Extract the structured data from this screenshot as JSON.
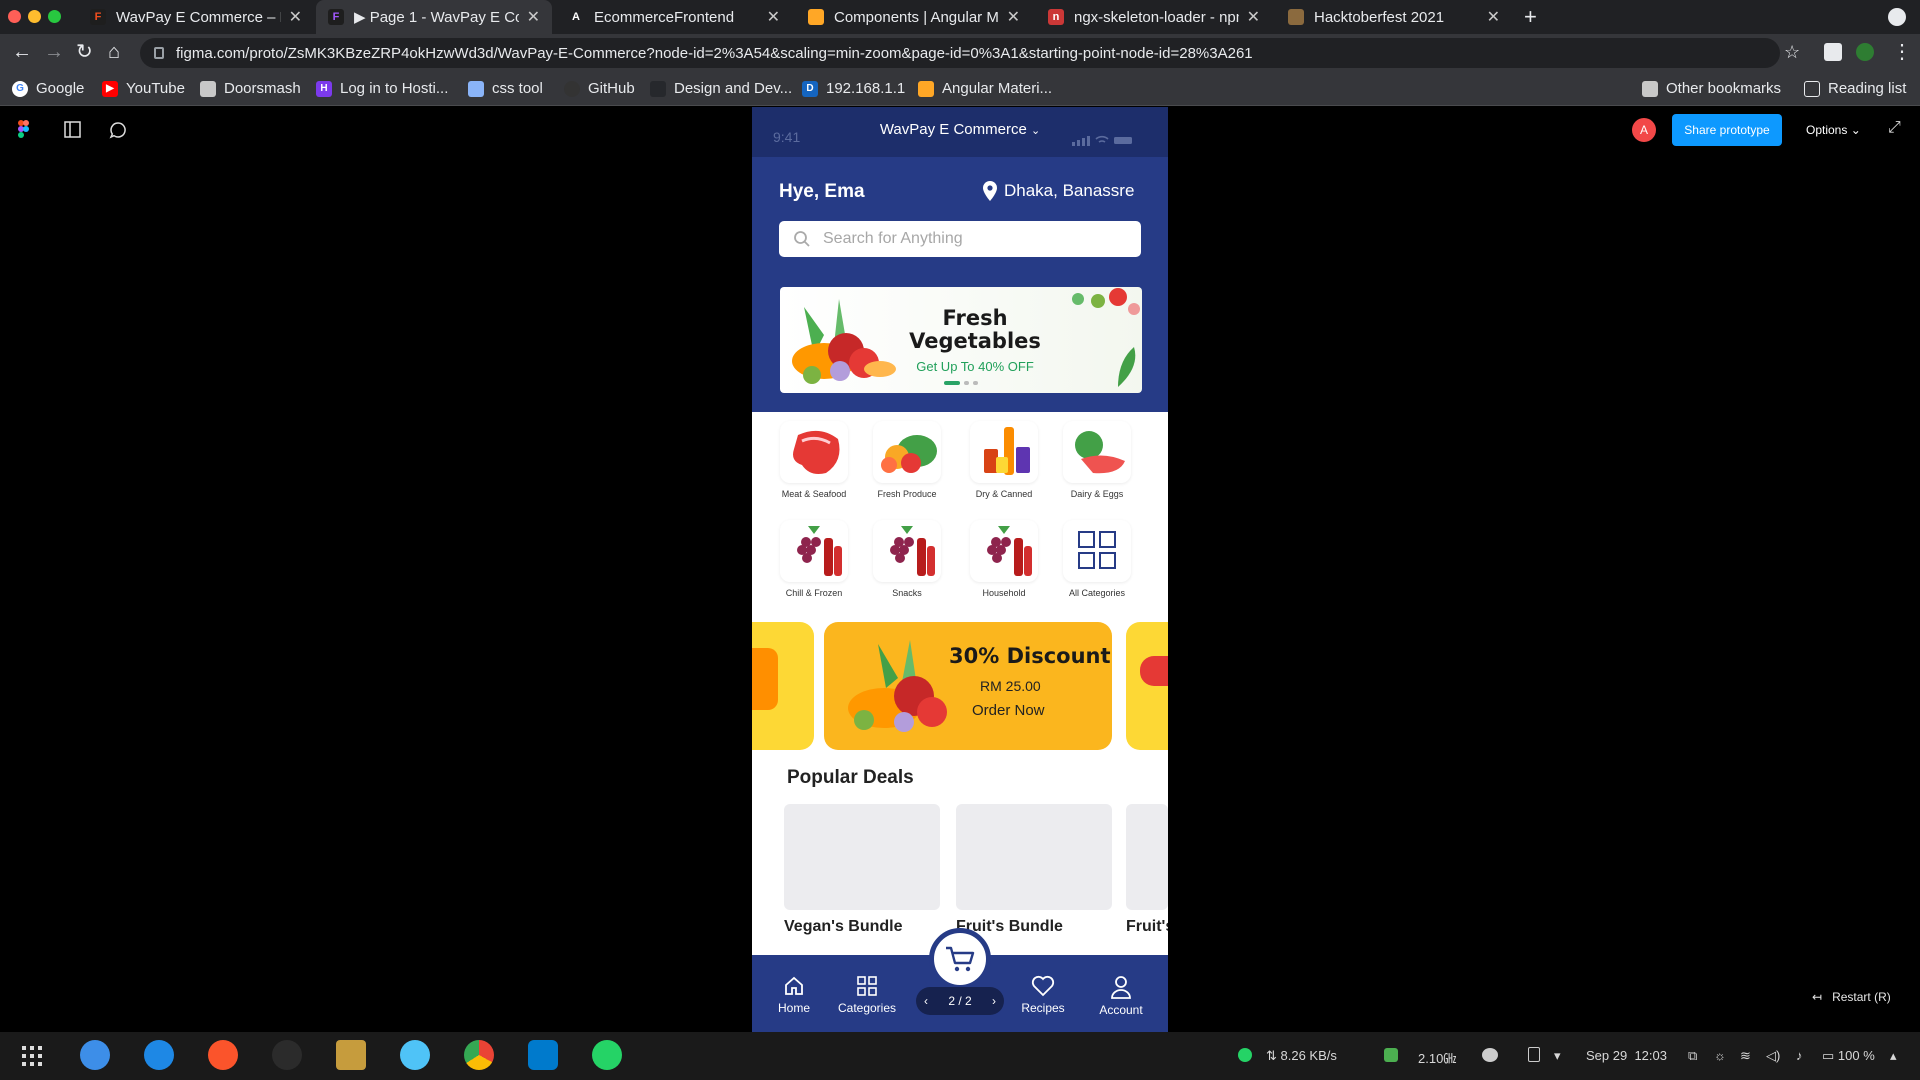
{
  "browser": {
    "tabs": [
      {
        "label": "WavPay E Commerce – Fi",
        "active": false,
        "favicon": "figma-icon"
      },
      {
        "label": "▶ Page 1 - WavPay E Com",
        "active": true,
        "favicon": "figma-icon"
      },
      {
        "label": "EcommerceFrontend",
        "active": false,
        "favicon": "angular-icon"
      },
      {
        "label": "Components | Angular Ma",
        "active": false,
        "favicon": "angular-material-icon"
      },
      {
        "label": "ngx-skeleton-loader - npm",
        "active": false,
        "favicon": "npm-icon"
      },
      {
        "label": "Hacktoberfest 2021",
        "active": false,
        "favicon": "hacktoberfest-icon"
      }
    ],
    "url": "figma.com/proto/ZsMK3KBzeZRP4okHzwWd3d/WavPay-E-Commerce?node-id=2%3A54&scaling=min-zoom&page-id=0%3A1&starting-point-node-id=28%3A261",
    "bookmarks": [
      {
        "label": "Google",
        "icon": "google-icon"
      },
      {
        "label": "YouTube",
        "icon": "youtube-icon"
      },
      {
        "label": "Doorsmash",
        "icon": "folder-icon"
      },
      {
        "label": "Log in to Hosti...",
        "icon": "hosting-icon"
      },
      {
        "label": "css tool",
        "icon": "folder-icon"
      },
      {
        "label": "GitHub",
        "icon": "github-icon"
      },
      {
        "label": "Design and Dev...",
        "icon": "design-icon"
      },
      {
        "label": "192.168.1.1",
        "icon": "router-icon"
      },
      {
        "label": "Angular Materi...",
        "icon": "angular-material-icon"
      }
    ],
    "other_bookmarks": "Other bookmarks",
    "reading_list": "Reading list"
  },
  "figma": {
    "avatar_letter": "A",
    "share_label": "Share prototype",
    "options_label": "Options",
    "restart_label": "Restart (R)"
  },
  "app": {
    "title": "WavPay E Commerce",
    "status_time": "9:41",
    "greeting": "Hye, Ema",
    "location": "Dhaka, Banassre",
    "search_placeholder": "Search for Anything",
    "banner": {
      "title": "Fresh Vegetables",
      "subtitle": "Get Up To 40% OFF"
    },
    "categories": [
      {
        "label": "Meat & Seafood",
        "icon": "meat-icon"
      },
      {
        "label": "Fresh Produce",
        "icon": "produce-icon"
      },
      {
        "label": "Dry & Canned",
        "icon": "canned-icon"
      },
      {
        "label": "Dairy & Eggs",
        "icon": "dairy-icon"
      },
      {
        "label": "Chill & Frozen",
        "icon": "grapes-wine-icon"
      },
      {
        "label": "Snacks",
        "icon": "grapes-wine-icon"
      },
      {
        "label": "Household",
        "icon": "grapes-wine-icon"
      },
      {
        "label": "All Categories",
        "icon": "grid-icon"
      }
    ],
    "promo": {
      "title": "30% Discount",
      "price": "RM 25.00",
      "cta": "Order Now"
    },
    "popular_title": "Popular Deals",
    "deals": [
      {
        "name": "Vegan's Bundle"
      },
      {
        "name": "Fruit's Bundle"
      },
      {
        "name": "Fruit's"
      }
    ],
    "nav": [
      {
        "label": "Home",
        "icon": "home-icon"
      },
      {
        "label": "Categories",
        "icon": "grid-icon"
      },
      {
        "label": "Recipes",
        "icon": "heart-icon"
      },
      {
        "label": "Account",
        "icon": "user-icon"
      }
    ],
    "pager": "2 / 2",
    "colors": {
      "primary": "#263b86",
      "accent": "#fbb61e",
      "green": "#29a366"
    }
  },
  "taskbar": {
    "net_speed": "8.26 KB/s",
    "cpu": "2.10㎓",
    "date": "Sep 29",
    "time": "12:03",
    "battery": "100 %"
  }
}
